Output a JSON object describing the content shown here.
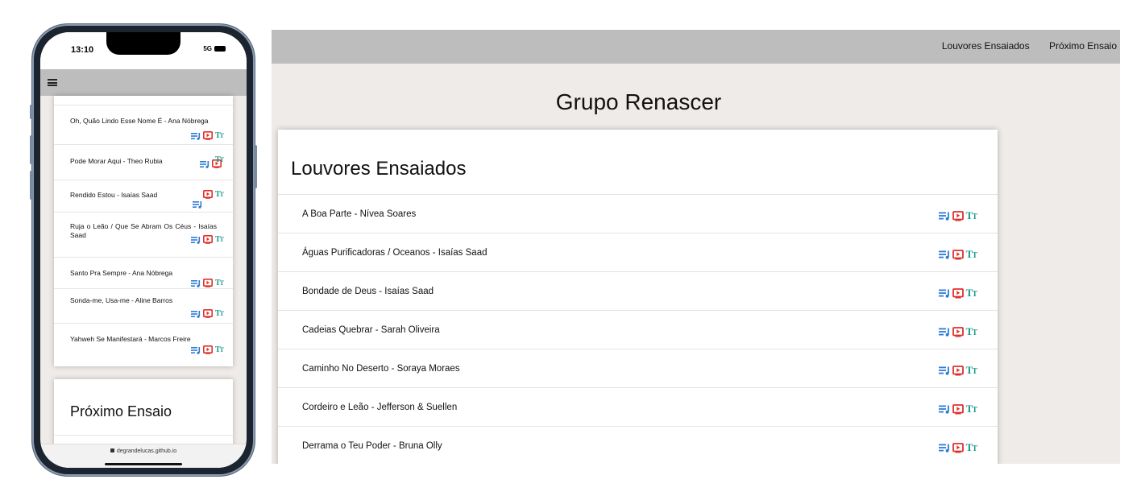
{
  "colors": {
    "accent_blue": "#2e7bd6",
    "youtube_red": "#e0302b",
    "font_teal": "#1a9a8c",
    "header_gray": "#bdbdbd",
    "page_bg": "#eeebe8"
  },
  "mobile": {
    "status": {
      "time": "13:10",
      "network": "5G"
    },
    "songs": [
      {
        "title": "Oh, Quão Lindo Esse Nome É - Ana Nóbrega"
      },
      {
        "title": "Pode Morar Aqui - Theo Rubia"
      },
      {
        "title": "Rendido Estou - Isaías Saad"
      },
      {
        "title": "Ruja o Leão / Que Se Abram Os Céus - Isaías Saad"
      },
      {
        "title": "Santo Pra Sempre - Ana Nóbrega"
      },
      {
        "title": "Sonda-me, Usa-me - Aline Barros"
      },
      {
        "title": "Yahweh Se Manifestará - Marcos Freire"
      }
    ],
    "next_section_title": "Próximo Ensaio",
    "url": "degrandelucas.github.io"
  },
  "desktop": {
    "nav": {
      "item1": "Louvores Ensaiados",
      "item2": "Próximo Ensaio"
    },
    "page_title": "Grupo Renascer",
    "section_title": "Louvores Ensaiados",
    "songs": [
      {
        "title": "A Boa Parte - Nívea Soares"
      },
      {
        "title": "Águas Purificadoras / Oceanos - Isaías Saad"
      },
      {
        "title": "Bondade de Deus - Isaías Saad"
      },
      {
        "title": "Cadeias Quebrar - Sarah Oliveira"
      },
      {
        "title": "Caminho No Deserto - Soraya Moraes"
      },
      {
        "title": "Cordeiro e Leão - Jefferson & Suellen"
      },
      {
        "title": "Derrama o Teu Poder - Bruna Olly"
      }
    ]
  },
  "icons": {
    "playlist": "playlist-icon",
    "video": "video-icon",
    "lyrics": "lyrics-icon"
  }
}
